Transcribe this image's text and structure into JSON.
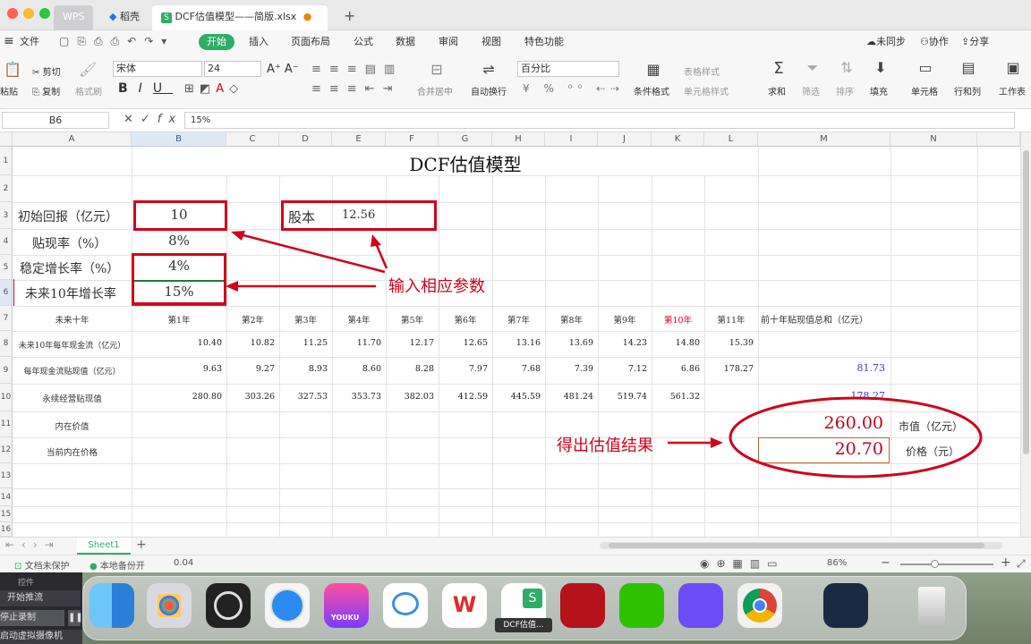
{
  "titlebar": {
    "tabs": [
      "WPS",
      "稻壳",
      "DCF估值模型——简版.xlsx"
    ]
  },
  "menu": {
    "file": "文件",
    "tabs": [
      "开始",
      "插入",
      "页面布局",
      "公式",
      "数据",
      "审阅",
      "视图",
      "特色功能"
    ],
    "right": [
      "未同步",
      "协作",
      "分享"
    ]
  },
  "toolbar": {
    "cut": "剪切",
    "copy": "复制",
    "paste": "粘贴",
    "format_painter": "格式刷",
    "font": "宋体",
    "size": "24",
    "merge": "合并居中",
    "wrap": "自动换行",
    "numfmt": "百分比",
    "condfmt": "条件格式",
    "table_style": "表格样式",
    "cell_style": "单元格样式",
    "sum": "求和",
    "filter": "筛选",
    "sort": "排序",
    "fill": "填充",
    "cell": "单元格",
    "rowcol": "行和列",
    "sheet": "工作表"
  },
  "formula": {
    "cellref": "B6",
    "content": "15%"
  },
  "columns": [
    "A",
    "B",
    "C",
    "D",
    "E",
    "F",
    "G",
    "H",
    "I",
    "J",
    "K",
    "L",
    "M",
    "N"
  ],
  "title": "DCF估值模型",
  "params": {
    "initial_label": "初始回报（亿元）",
    "initial_value": "10",
    "discount_label": "贴现率（%）",
    "discount_value": "8%",
    "stable_label": "稳定增长率（%）",
    "stable_value": "4%",
    "future_label": "未来10年增长率",
    "future_value": "15%",
    "shares_label": "股本",
    "shares_value": "12.56"
  },
  "table": {
    "row7_label": "未来十年",
    "years": [
      "第1年",
      "第2年",
      "第3年",
      "第4年",
      "第5年",
      "第6年",
      "第7年",
      "第8年",
      "第9年",
      "第10年",
      "第11年"
    ],
    "pv_total_label": "前十年贴现值总和（亿元）",
    "row8_label": "未来10年每年现金流（亿元）",
    "row8": [
      "10.40",
      "10.82",
      "11.25",
      "11.70",
      "12.17",
      "12.65",
      "13.16",
      "13.69",
      "14.23",
      "14.80",
      "15.39"
    ],
    "row9_label": "每年现金流贴现值（亿元）",
    "row9": [
      "9.63",
      "9.27",
      "8.93",
      "8.60",
      "8.28",
      "7.97",
      "7.68",
      "7.39",
      "7.12",
      "6.86",
      "178.27"
    ],
    "row9_total": "81.73",
    "row10_label": "永续经营贴现值",
    "row10": [
      "280.80",
      "303.26",
      "327.53",
      "353.73",
      "382.03",
      "412.59",
      "445.59",
      "481.24",
      "519.74",
      "561.32"
    ],
    "row10_total": "178.27",
    "row11_label": "内在价值",
    "market_value": "260.00",
    "market_value_label": "市值（亿元）",
    "row12_label": "当前内在价格",
    "price": "20.70",
    "price_label": "价格（元）"
  },
  "annotations": {
    "input_note": "输入相应参数",
    "result_note": "得出估值结果"
  },
  "sheetbar": {
    "sheet_name": "Sheet1",
    "add": "+"
  },
  "statusbar": {
    "unprotected": "文档未保护",
    "backup": "本地备份开",
    "value": "0.04",
    "zoom": "86%"
  },
  "obs": {
    "controls": "控件",
    "start_stream": "开始推流",
    "stop_record": "停止录制",
    "virtual_cam": "启动虚拟摄像机"
  },
  "dock": {
    "tooltip": "DCF估值...",
    "youku": "YOUKU"
  },
  "colors": {
    "accent_green": "#2cae66",
    "red": "#d0021b"
  }
}
